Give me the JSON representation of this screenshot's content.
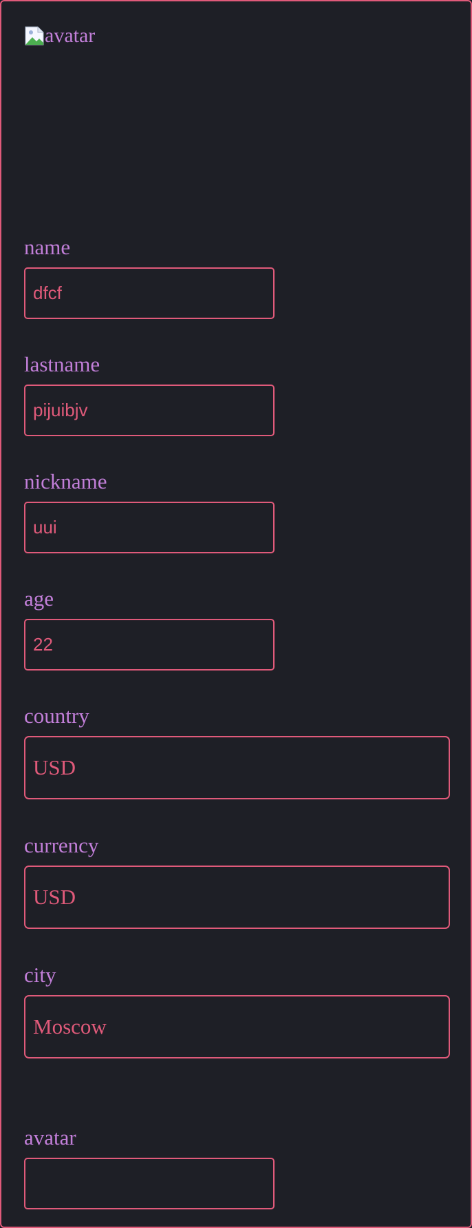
{
  "avatar": {
    "alt_text": "avatar",
    "icon": "broken-image-icon"
  },
  "form": {
    "name": {
      "label": "name",
      "value": "dfcf"
    },
    "lastname": {
      "label": "lastname",
      "value": "pijuibjv"
    },
    "nickname": {
      "label": "nickname",
      "value": "uui"
    },
    "age": {
      "label": "age",
      "value": "22"
    },
    "country": {
      "label": "country",
      "value": "USD"
    },
    "currency": {
      "label": "currency",
      "value": "USD"
    },
    "city": {
      "label": "city",
      "value": "Moscow"
    },
    "avatar": {
      "label": "avatar",
      "value": ""
    }
  },
  "colors": {
    "background": "#1e1f26",
    "accent_border": "#e05a7a",
    "label_text": "#c27fd9",
    "value_text": "#e05a7a"
  }
}
